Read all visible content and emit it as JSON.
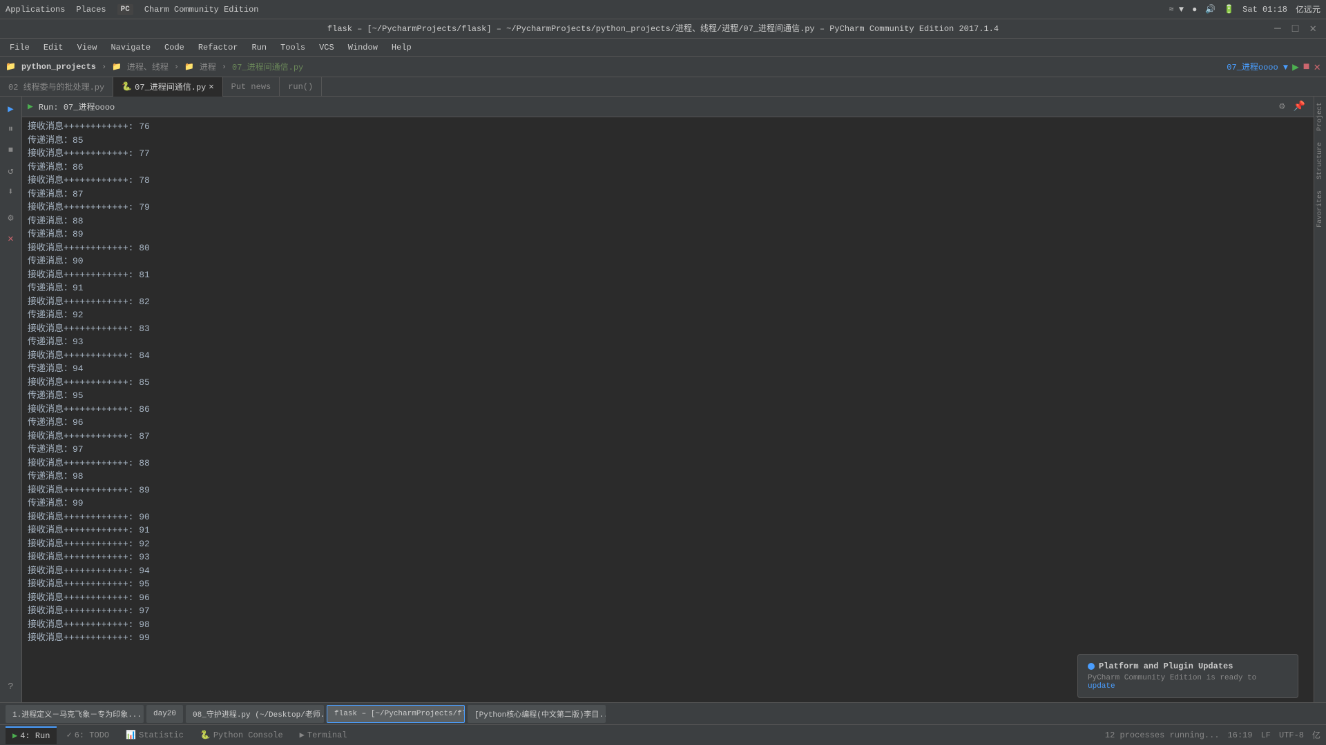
{
  "systemBar": {
    "applications": "Applications",
    "places": "Places",
    "appIcon": "PC",
    "appName": "Charm Community Edition",
    "time": "Sat 01:18",
    "rightIcons": [
      "≈",
      "▼",
      "●",
      "▼",
      "🔊",
      "🔋",
      "亿远元"
    ]
  },
  "titleBar": {
    "text": "flask – [~/PycharmProjects/flask] – ~/PycharmProjects/python_projects/进程、线程/进程/07_进程间通信.py – PyCharm Community Edition 2017.1.4"
  },
  "menuBar": {
    "items": [
      "File",
      "Edit",
      "View",
      "Navigate",
      "Code",
      "Refactor",
      "Run",
      "Tools",
      "VCS",
      "Window",
      "Help"
    ]
  },
  "projectBar": {
    "projectName": "python_projects",
    "breadcrumbs": [
      "进程、线程",
      "进程"
    ],
    "currentFile": "07_进程间通信.py",
    "runConfig": "07_进程oooo",
    "toolbar": {
      "settingsIcon": "⚙",
      "runIcon": "▶",
      "stopIcon": "■",
      "closeIcon": "✕"
    }
  },
  "tabs": [
    {
      "label": "02 线程委与的批处理.py",
      "active": false
    },
    {
      "label": "07_进程间通信.py",
      "active": true
    },
    {
      "label": "Put  news",
      "active": false
    },
    {
      "label": "run()",
      "active": false
    }
  ],
  "runToolbar": {
    "label": "Run: 07_进程oooo",
    "settingsIcon": "⚙",
    "pinIcon": "📌",
    "closeIcon": "✕"
  },
  "outputLines": [
    "接收消息++++++++++++: 76",
    "传递消息：85",
    "接收消息++++++++++++: 77",
    "传递消息：86",
    "接收消息++++++++++++: 78",
    "传递消息：87",
    "接收消息++++++++++++: 79",
    "传递消息：88",
    "传递消息：89",
    "接收消息++++++++++++: 80",
    "传递消息：90",
    "接收消息++++++++++++: 81",
    "传递消息：91",
    "接收消息++++++++++++: 82",
    "传递消息：92",
    "接收消息++++++++++++: 83",
    "传递消息：93",
    "接收消息++++++++++++: 84",
    "传递消息：94",
    "接收消息++++++++++++: 85",
    "传递消息：95",
    "接收消息++++++++++++: 86",
    "传递消息：96",
    "接收消息++++++++++++: 87",
    "传递消息：97",
    "接收消息++++++++++++: 88",
    "传递消息：98",
    "接收消息++++++++++++: 89",
    "传递消息：99",
    "接收消息++++++++++++: 90",
    "接收消息++++++++++++: 91",
    "接收消息++++++++++++: 92",
    "接收消息++++++++++++: 93",
    "接收消息++++++++++++: 94",
    "接收消息++++++++++++: 95",
    "接收消息++++++++++++: 96",
    "接收消息++++++++++++: 97",
    "接收消息++++++++++++: 98",
    "接收消息++++++++++++: 99"
  ],
  "leftSidebarIcons": [
    {
      "icon": "▶",
      "name": "run-icon",
      "active": true
    },
    {
      "icon": "⏸",
      "name": "pause-icon",
      "active": false
    },
    {
      "icon": "⏹",
      "name": "stop-icon",
      "active": false
    },
    {
      "icon": "↺",
      "name": "restart-icon",
      "active": false
    },
    {
      "icon": "⬇",
      "name": "resume-icon",
      "active": false
    },
    {
      "icon": "🔧",
      "name": "settings-icon",
      "active": false
    },
    {
      "icon": "✕",
      "name": "close-red-icon",
      "active": false,
      "red": true
    },
    {
      "icon": "?",
      "name": "help-icon",
      "active": false
    }
  ],
  "rightLabels": [
    "Project",
    "Structure",
    "Favorites"
  ],
  "bottomTabs": [
    {
      "label": "4: Run",
      "icon": "▶",
      "active": true,
      "number": "4"
    },
    {
      "label": "6: TODO",
      "icon": "✓",
      "active": false,
      "number": "6"
    },
    {
      "label": "Statistic",
      "icon": "📊",
      "active": false
    },
    {
      "label": "Python Console",
      "icon": "🐍",
      "active": false
    },
    {
      "label": "Terminal",
      "icon": "▶",
      "active": false
    }
  ],
  "bottomRight": {
    "processes": "12 processes running...",
    "time": "16:19",
    "lineEnding": "LF",
    "encoding": "UTF-8",
    "extra": "亿"
  },
  "taskbarItems": [
    {
      "label": "1.进程定义－马克飞象－专为印象...",
      "active": false
    },
    {
      "label": "day20",
      "active": false
    },
    {
      "label": "08_守护进程.py (~/Desktop/老师...",
      "active": false
    },
    {
      "label": "flask – [~/PycharmProjects/flask]...",
      "active": true
    },
    {
      "label": "[Python核心编程(中文第二版)李目...",
      "active": false
    }
  ],
  "notification": {
    "title": "Platform and Plugin Updates",
    "body": "PyCharm Community Edition is ready to ",
    "linkText": "update",
    "dotColor": "#4a9eff"
  }
}
